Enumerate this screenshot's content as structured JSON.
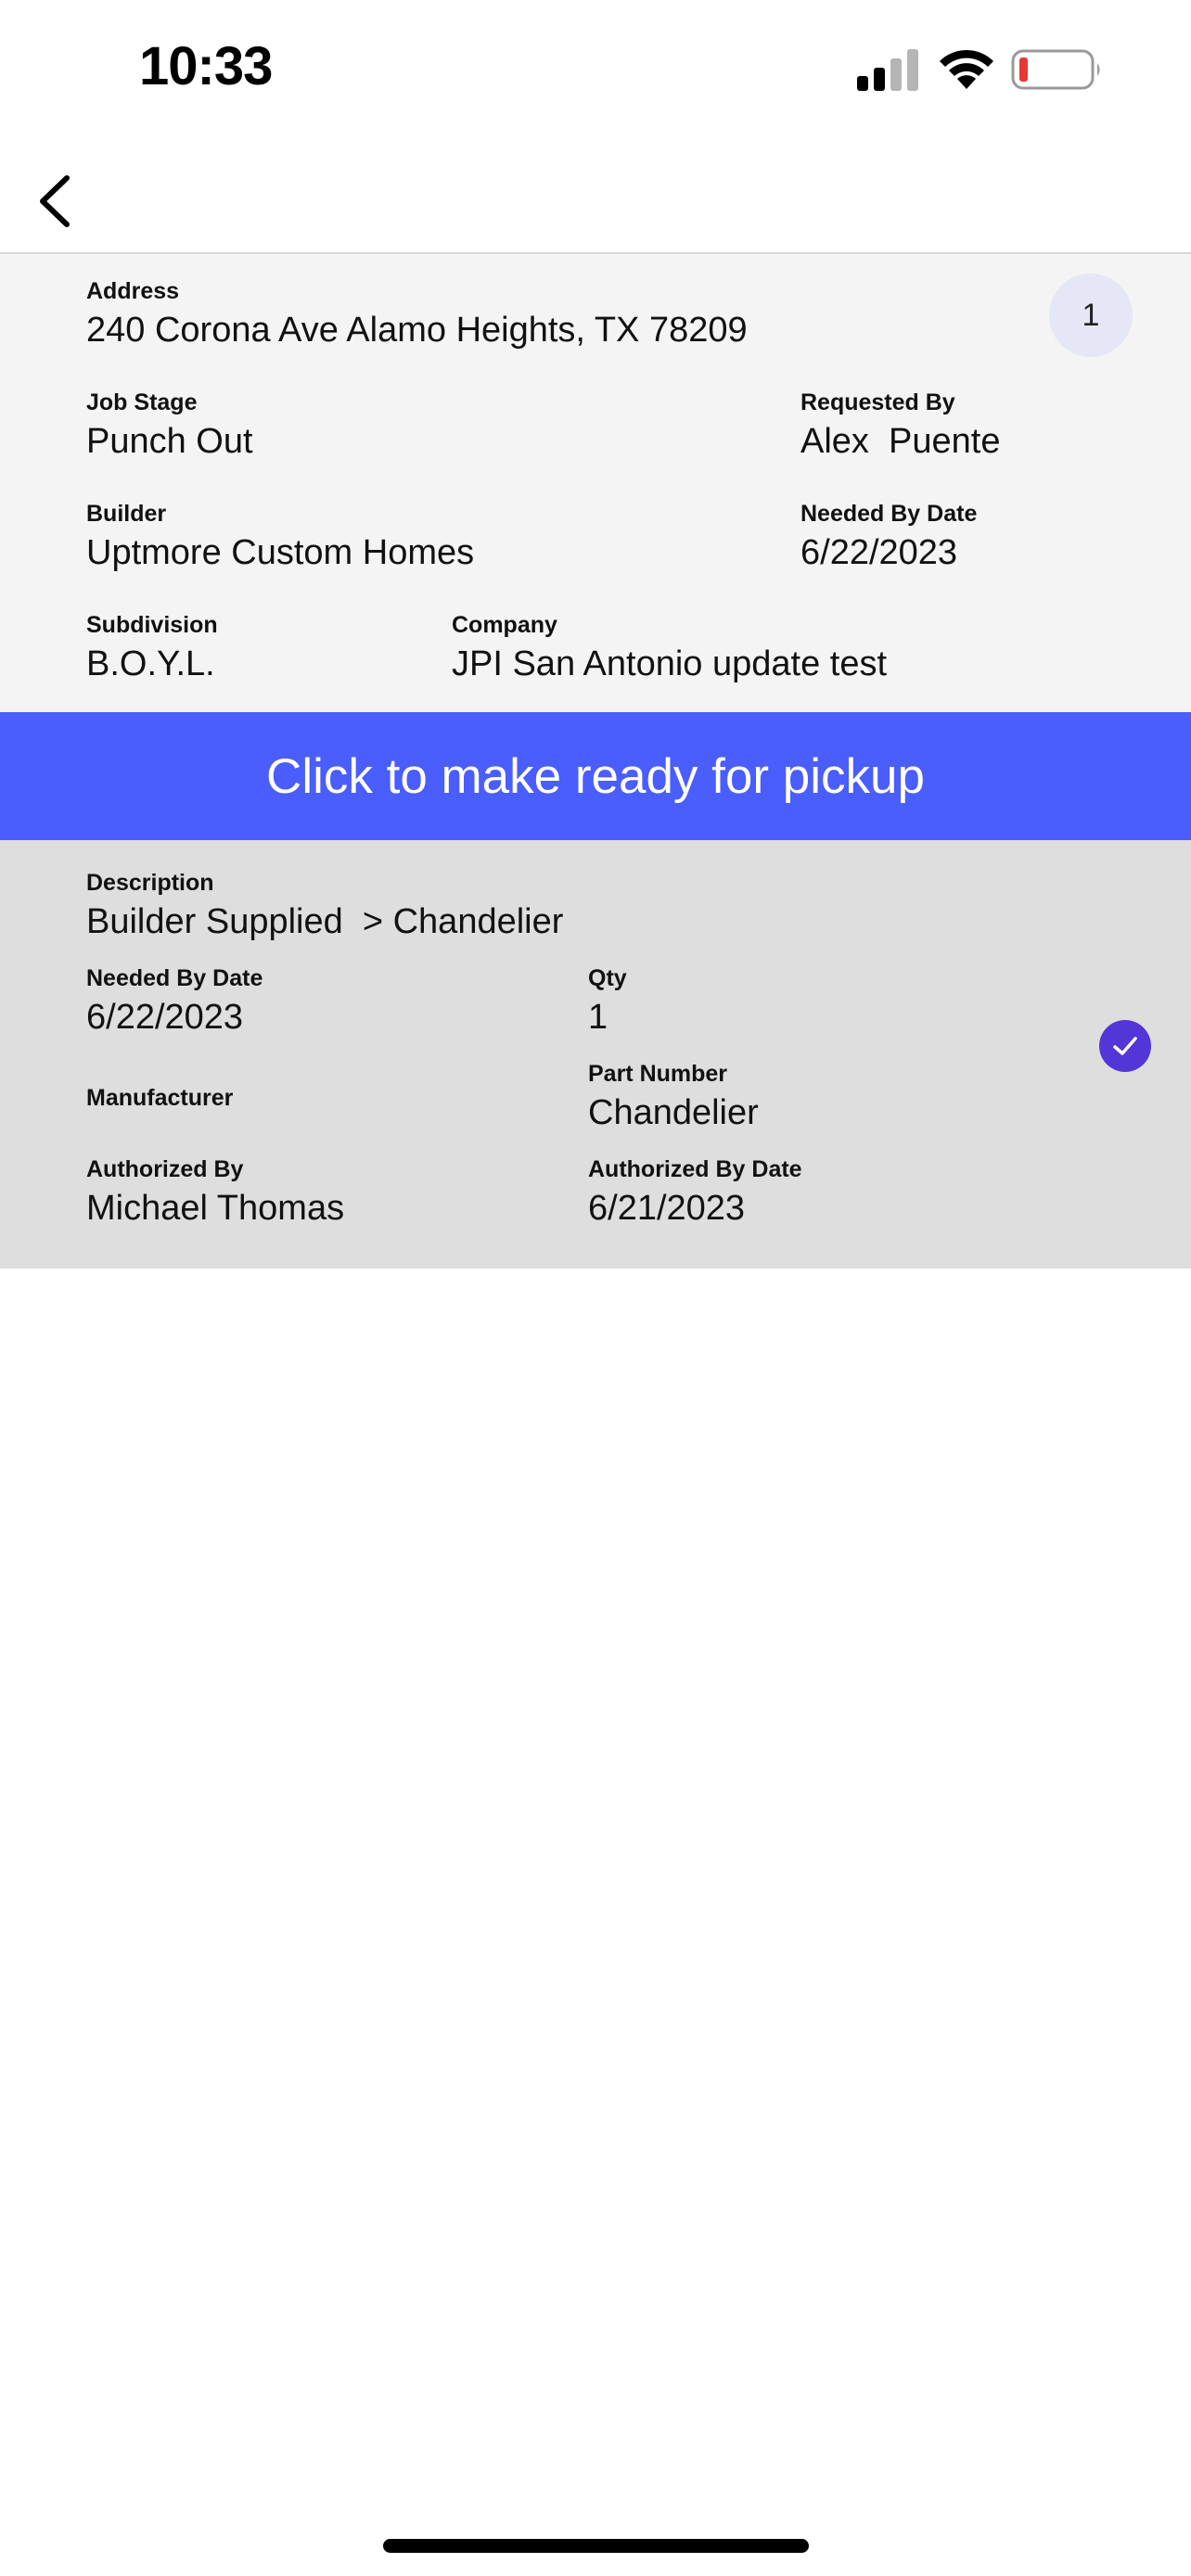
{
  "status_bar": {
    "time": "10:33",
    "icons": [
      "signal-icon",
      "wifi-icon",
      "battery-low-icon"
    ],
    "battery_color": "#e53935"
  },
  "nav": {
    "back_icon": "chevron-left-icon"
  },
  "job": {
    "count_badge": "1",
    "address": {
      "label": "Address",
      "value": "240 Corona Ave Alamo Heights, TX 78209"
    },
    "job_stage": {
      "label": "Job Stage",
      "value": "Punch Out"
    },
    "requested_by": {
      "label": "Requested By",
      "value": "Alex  Puente"
    },
    "builder": {
      "label": "Builder",
      "value": "Uptmore Custom Homes"
    },
    "needed_by_date": {
      "label": "Needed By Date",
      "value": "6/22/2023"
    },
    "subdivision": {
      "label": "Subdivision",
      "value": "B.O.Y.L."
    },
    "company": {
      "label": "Company",
      "value": "JPI San Antonio update test"
    }
  },
  "action": {
    "ready_label": "Click to make ready for pickup",
    "color": "#4a5dfd"
  },
  "item": {
    "description": {
      "label": "Description",
      "value": "Builder Supplied  > Chandelier"
    },
    "needed_by_date": {
      "label": "Needed By Date",
      "value": "6/22/2023"
    },
    "qty": {
      "label": "Qty",
      "value": "1"
    },
    "manufacturer": {
      "label": "Manufacturer",
      "value": ""
    },
    "part_number": {
      "label": "Part Number",
      "value": "Chandelier"
    },
    "authorized_by": {
      "label": "Authorized By",
      "value": "Michael Thomas"
    },
    "authorized_by_date": {
      "label": "Authorized By Date",
      "value": "6/21/2023"
    },
    "selected": true,
    "check_icon": "checkmark-icon",
    "check_color": "#5435d8"
  }
}
